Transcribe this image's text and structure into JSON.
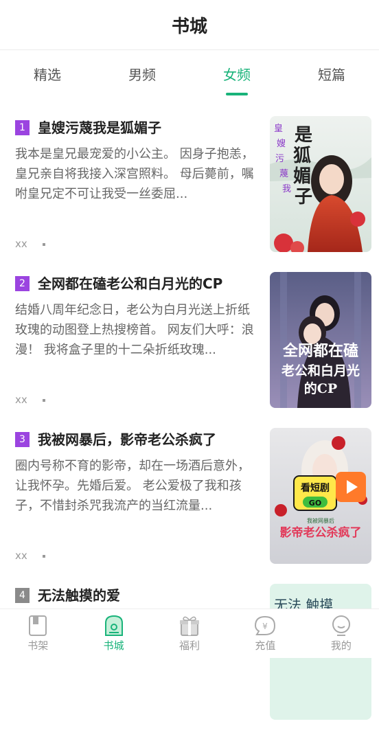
{
  "header": {
    "title": "书城"
  },
  "tabs": [
    {
      "label": "精选"
    },
    {
      "label": "男频"
    },
    {
      "label": "女频"
    },
    {
      "label": "短篇"
    }
  ],
  "books": [
    {
      "rank": "1",
      "title": "皇嫂污蔑我是狐媚子",
      "desc": "我本是皇兄最宠爱的小公主。 因身子抱恙，皇兄亲自将我接入深宫照料。 母后薨前，嘱咐皇兄定不可让我受一丝委屈...",
      "author": "xx",
      "cover_text": [
        "是",
        "狐",
        "媚",
        "子"
      ],
      "cover_side": "皇嫂污蔑我"
    },
    {
      "rank": "2",
      "title": "全网都在磕老公和白月光的CP",
      "desc": "结婚八周年纪念日，老公为白月光送上折纸玫瑰的动图登上热搜榜首。 网友们大呼：浪漫！ 我将盒子里的十二朵折纸玫瑰...",
      "author": "xx",
      "cover_text": [
        "全网都在磕",
        "老公和白月光",
        "的CP"
      ]
    },
    {
      "rank": "3",
      "title": "我被网暴后，影帝老公杀疯了",
      "desc": "圈内号称不育的影帝，却在一场酒后意外，让我怀孕。先婚后爱。 老公爱极了我和孩子，不惜封杀咒我流产的当红流量...",
      "author": "xx",
      "cover_badge": "看短剧",
      "cover_go": "GO",
      "cover_small": "我被网暴后",
      "cover_title": "影帝老公杀疯了"
    },
    {
      "rank": "4",
      "title": "无法触摸的爱",
      "cover_text": [
        "无法 触摸"
      ]
    }
  ],
  "tabbar": [
    {
      "label": "书架",
      "icon": "bookshelf-icon"
    },
    {
      "label": "书城",
      "icon": "bookstore-icon"
    },
    {
      "label": "福利",
      "icon": "gift-icon"
    },
    {
      "label": "充值",
      "icon": "recharge-icon"
    },
    {
      "label": "我的",
      "icon": "profile-icon"
    }
  ],
  "colors": {
    "accent": "#19b37a",
    "rank_purple": "#9b44e0",
    "rank_gray": "#8a8a8a"
  }
}
